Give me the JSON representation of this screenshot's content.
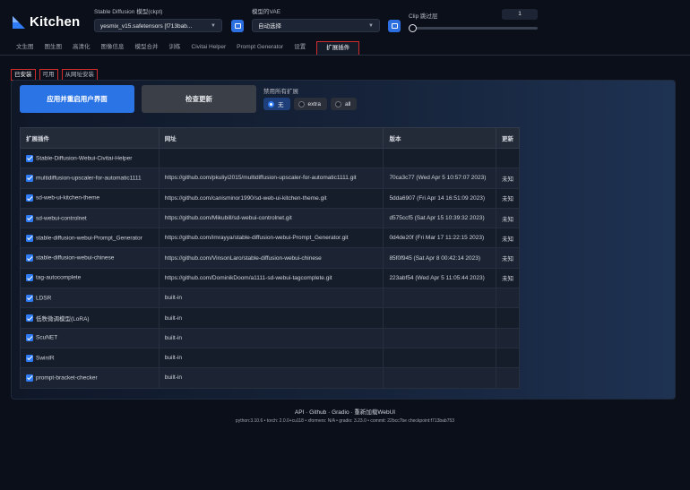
{
  "app": {
    "title": "Kitchen"
  },
  "header": {
    "ckpt_label": "Stable Diffusion 模型(ckpt)",
    "ckpt_value": "yesmix_v15.safetensors [f713bab...",
    "vae_label": "模型的VAE",
    "vae_value": "自动选择",
    "clip_label": "Clip 跳过层",
    "clip_value": "1"
  },
  "tabs": [
    "文生图",
    "图生图",
    "高清化",
    "图像信息",
    "模型合并",
    "训练",
    "Civitai Helper",
    "Prompt Generator",
    "设置",
    "扩展插件"
  ],
  "active_tab": "扩展插件",
  "subtabs": [
    "已安装",
    "可用",
    "从网址安装"
  ],
  "buttons": {
    "apply": "应用并重启用户界面",
    "check": "检查更新"
  },
  "disable_all": {
    "label": "禁用所有扩展",
    "options": [
      "无",
      "extra",
      "all"
    ],
    "selected": "无"
  },
  "table": {
    "headers": [
      "扩展插件",
      "网址",
      "版本",
      "更新"
    ],
    "rows": [
      {
        "name": "Stable-Diffusion-Webui-Civitai-Helper",
        "url": "",
        "version": "",
        "update": ""
      },
      {
        "name": "multidiffusion-upscaler-for-automatic1111",
        "url": "https://github.com/pkuliyi2015/multidiffusion-upscaler-for-automatic1111.git",
        "version": "70ca3c77 (Wed Apr 5 10:57:07 2023)",
        "update": "未知"
      },
      {
        "name": "sd-web-ui-kitchen-theme",
        "url": "https://github.com/canisminor1990/sd-web-ui-kitchen-theme.git",
        "version": "5dda6907 (Fri Apr 14 16:51:09 2023)",
        "update": "未知"
      },
      {
        "name": "sd-webui-controlnet",
        "url": "https://github.com/Mikubill/sd-webui-controlnet.git",
        "version": "d575ccf5 (Sat Apr 15 10:39:32 2023)",
        "update": "未知"
      },
      {
        "name": "stable-diffusion-webui-Prompt_Generator",
        "url": "https://github.com/imrayya/stable-diffusion-webui-Prompt_Generator.git",
        "version": "0d4de20f (Fri Mar 17 11:22:15 2023)",
        "update": "未知"
      },
      {
        "name": "stable-diffusion-webui-chinese",
        "url": "https://github.com/VinsonLaro/stable-diffusion-webui-chinese",
        "version": "85f0f945 (Sat Apr 8 00:42:14 2023)",
        "update": "未知"
      },
      {
        "name": "tag-autocomplete",
        "url": "https://github.com/DominikDoom/a1111-sd-webui-tagcomplete.git",
        "version": "223abf54 (Wed Apr 5 11:05:44 2023)",
        "update": "未知"
      },
      {
        "name": "LDSR",
        "url": "built-in",
        "version": "",
        "update": ""
      },
      {
        "name": "低秩微调模型(LoRA)",
        "url": "built-in",
        "version": "",
        "update": ""
      },
      {
        "name": "ScuNET",
        "url": "built-in",
        "version": "",
        "update": ""
      },
      {
        "name": "SwinIR",
        "url": "built-in",
        "version": "",
        "update": ""
      },
      {
        "name": "prompt-bracket-checker",
        "url": "built-in",
        "version": "",
        "update": ""
      }
    ]
  },
  "footer": {
    "links": "API · Github · Gradio · 重新加载WebUI",
    "info": "python:3.10.6  •  torch: 2.0.0+cu118  •  xformers: N/A  •  gradio: 3.23.0  •  commit: 22bcc7be  checkpoint:f713bab753"
  },
  "colors": {
    "accent": "#2a74e6",
    "background": "#0b0f19",
    "highlight_border": "#d12c2c"
  }
}
